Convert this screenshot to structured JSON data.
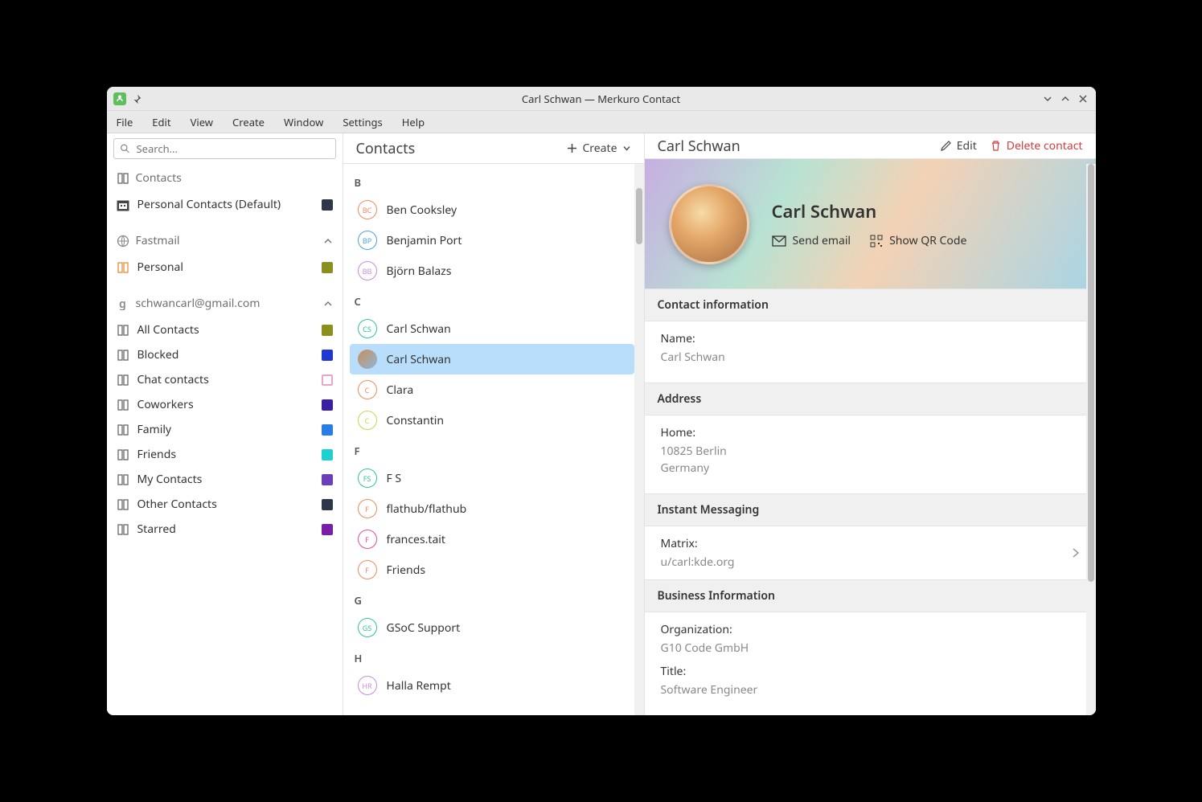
{
  "titlebar": {
    "title": "Carl Schwan — Merkuro Contact"
  },
  "menubar": [
    "File",
    "Edit",
    "View",
    "Create",
    "Window",
    "Settings",
    "Help"
  ],
  "sidebar": {
    "search_placeholder": "Search…",
    "groups": [
      {
        "header": "Contacts",
        "icon": "book",
        "items": [
          {
            "label": "Personal Contacts (Default)",
            "icon": "calendar",
            "color": "#2d3748"
          }
        ]
      },
      {
        "header": "Fastmail",
        "icon": "globe",
        "collapsible": true,
        "items": [
          {
            "label": "Personal",
            "icon": "book-orange",
            "color": "#8a8f1d"
          }
        ]
      },
      {
        "header": "schwancarl@gmail.com",
        "icon": "google",
        "collapsible": true,
        "items": [
          {
            "label": "All Contacts",
            "icon": "book",
            "color": "#8a8f1d"
          },
          {
            "label": "Blocked",
            "icon": "book",
            "color": "#2038d0"
          },
          {
            "label": "Chat contacts",
            "icon": "book",
            "color": "#ffffff",
            "border": "#e8a3cf"
          },
          {
            "label": "Coworkers",
            "icon": "book",
            "color": "#3a1fa3"
          },
          {
            "label": "Family",
            "icon": "book",
            "color": "#2a7de1"
          },
          {
            "label": "Friends",
            "icon": "book",
            "color": "#1fd0d0"
          },
          {
            "label": "My Contacts",
            "icon": "book",
            "color": "#6a3fb8"
          },
          {
            "label": "Other Contacts",
            "icon": "book",
            "color": "#2d3748"
          },
          {
            "label": "Starred",
            "icon": "book",
            "color": "#7a1fa3"
          }
        ]
      }
    ]
  },
  "list": {
    "title": "Contacts",
    "create_label": "Create",
    "sections": [
      {
        "letter": "B",
        "contacts": [
          {
            "name": "Ben Cooksley",
            "initials": "BC",
            "ring": "#f08a5d"
          },
          {
            "name": "Benjamin Port",
            "initials": "BP",
            "ring": "#4aa3e0"
          },
          {
            "name": "Björn Balazs",
            "initials": "BB",
            "ring": "#c38ce0"
          }
        ]
      },
      {
        "letter": "C",
        "contacts": [
          {
            "name": "Carl Schwan",
            "initials": "CS",
            "ring": "#2ec4a0"
          },
          {
            "name": "Carl Schwan",
            "photo": true,
            "selected": true
          },
          {
            "name": "Clara",
            "initials": "C",
            "ring": "#f08a5d"
          },
          {
            "name": "Constantin",
            "initials": "C",
            "ring": "#c7d94a"
          }
        ]
      },
      {
        "letter": "F",
        "contacts": [
          {
            "name": "F S",
            "initials": "FS",
            "ring": "#2ec4a0"
          },
          {
            "name": "flathub/flathub",
            "initials": "F",
            "ring": "#f08a5d"
          },
          {
            "name": "frances.tait",
            "initials": "F",
            "ring": "#e84a9b"
          },
          {
            "name": "Friends",
            "initials": "F",
            "ring": "#f08a5d"
          }
        ]
      },
      {
        "letter": "G",
        "contacts": [
          {
            "name": "GSoC Support",
            "initials": "GS",
            "ring": "#2ec4a0"
          }
        ]
      },
      {
        "letter": "H",
        "contacts": [
          {
            "name": "Halla Rempt",
            "initials": "HR",
            "ring": "#c38ce0"
          }
        ]
      }
    ]
  },
  "detail": {
    "title": "Carl Schwan",
    "edit_label": "Edit",
    "delete_label": "Delete contact",
    "hero_name": "Carl Schwan",
    "send_email_label": "Send email",
    "qr_label": "Show QR Code",
    "sections": {
      "contact_info": {
        "header": "Contact information",
        "name_label": "Name:",
        "name_value": "Carl Schwan"
      },
      "address": {
        "header": "Address",
        "type": "Home:",
        "line1": "10825 Berlin",
        "line2": "Germany"
      },
      "im": {
        "header": "Instant Messaging",
        "type": "Matrix:",
        "value": "u/carl:kde.org"
      },
      "business": {
        "header": "Business Information",
        "org_label": "Organization:",
        "org_value": "G10 Code GmbH",
        "title_label": "Title:",
        "title_value": "Software Engineer"
      }
    }
  }
}
